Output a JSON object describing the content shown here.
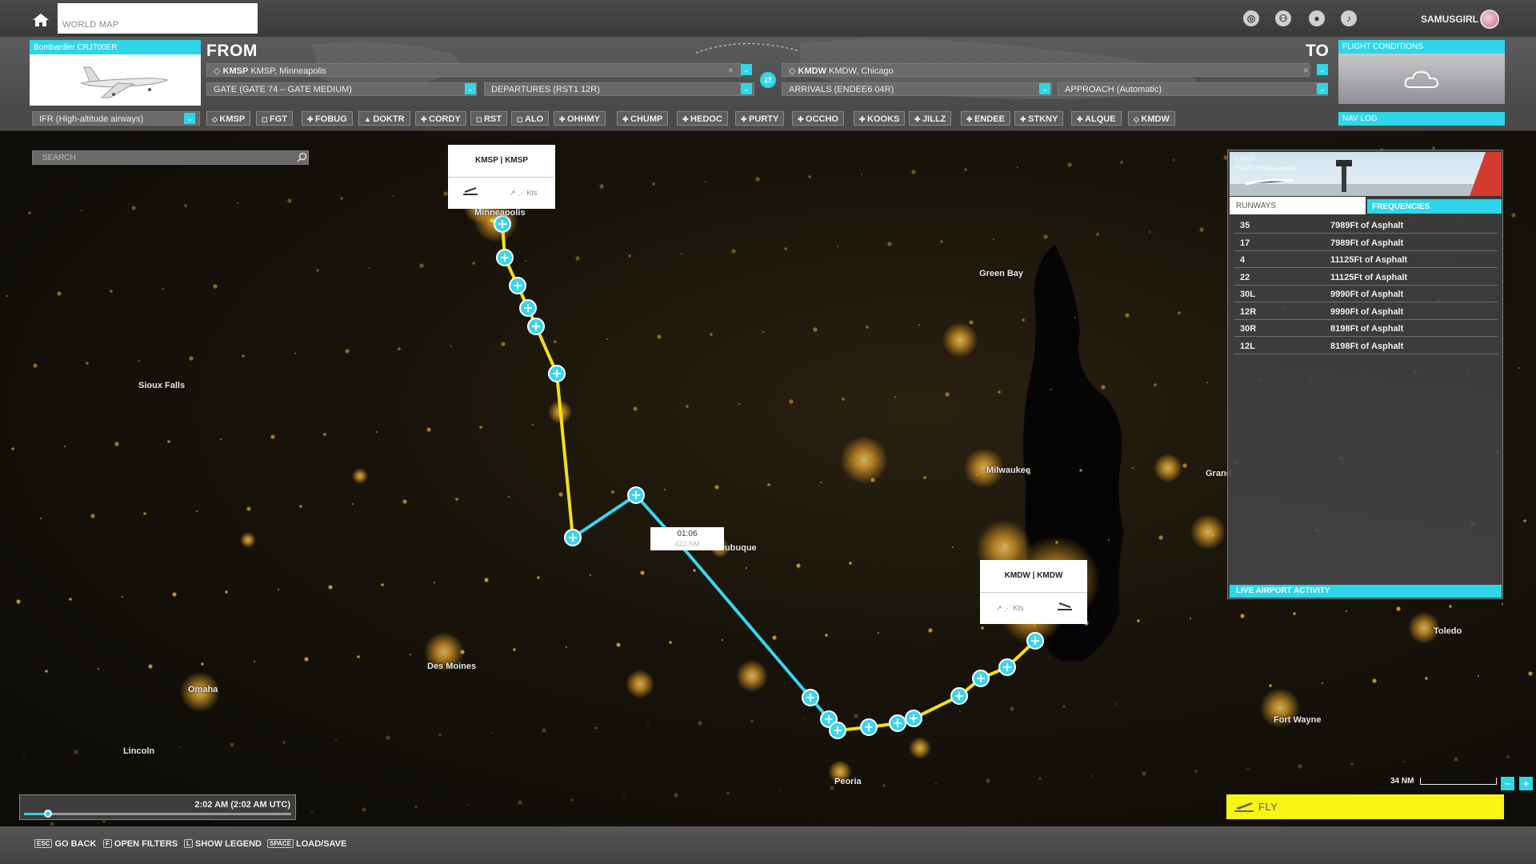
{
  "topbar": {
    "tab_label": "WORLD MAP",
    "username": "SAMUSGIRL"
  },
  "aircraft": {
    "name": "Bombardier CRJ700ER"
  },
  "route": {
    "from_label": "FROM",
    "to_label": "TO",
    "from_code": "KMSP",
    "from_name": "KMSP, Minneapolis",
    "to_code": "KMDW",
    "to_name": "KMDW, Chicago",
    "gate": "GATE (GATE 74 – GATE MEDIUM)",
    "departure": "DEPARTURES (RST1 12R)",
    "arrival": "ARRIVALS (ENDEE6 04R)",
    "approach": "APPROACH (Automatic)",
    "flight_conditions_label": "FLIGHT CONDITIONS",
    "altitude_mode": "IFR (High-altitude airways)",
    "nav_log_label": "NAV LOG",
    "waypoints": [
      {
        "icon": "airport",
        "name": "KMSP"
      },
      {
        "icon": "vor",
        "name": "FGT"
      },
      {
        "icon": "intersection",
        "name": "FOBUG"
      },
      {
        "icon": "triangle",
        "name": "DOKTR"
      },
      {
        "icon": "intersection",
        "name": "CORDY"
      },
      {
        "icon": "vor",
        "name": "RST"
      },
      {
        "icon": "vor",
        "name": "ALO"
      },
      {
        "icon": "intersection",
        "name": "OHHMY"
      },
      {
        "icon": "intersection",
        "name": "CHUMP"
      },
      {
        "icon": "intersection",
        "name": "HEDOC"
      },
      {
        "icon": "intersection",
        "name": "PURTY"
      },
      {
        "icon": "intersection",
        "name": "OCCHO"
      },
      {
        "icon": "intersection",
        "name": "KOOKS"
      },
      {
        "icon": "intersection",
        "name": "JILLZ"
      },
      {
        "icon": "intersection",
        "name": "ENDEE"
      },
      {
        "icon": "intersection",
        "name": "STKNY"
      },
      {
        "icon": "intersection",
        "name": "ALQUE"
      },
      {
        "icon": "airport",
        "name": "KMDW"
      }
    ]
  },
  "map": {
    "search_placeholder": "SEARCH",
    "cities": [
      "Sioux Falls",
      "Green Bay",
      "Milwaukee",
      "Dubuque",
      "Des Moines",
      "Omaha",
      "Lincoln",
      "Peoria",
      "Fort Wayne",
      "Toledo",
      "Grand",
      "Minneapolis"
    ],
    "origin_card": {
      "code": "KMSP",
      "name": "KMSP",
      "speed_unit": "Kts"
    },
    "dest_card": {
      "code": "KMDW",
      "name": "KMDW",
      "speed_unit": "Kts"
    },
    "leg_time": "01:06",
    "leg_distance": "422 NM",
    "scale_label": "34 NM"
  },
  "airport_panel": {
    "photo_caption": "KMSP",
    "photo_subcaption": "KMSP, Minneapolis",
    "tab_runways": "RUNWAYS",
    "tab_frequencies": "FREQUENCIES",
    "runways": [
      {
        "number": "35",
        "detail": "7989Ft of Asphalt"
      },
      {
        "number": "17",
        "detail": "7989Ft of Asphalt"
      },
      {
        "number": "4",
        "detail": "11125Ft of Asphalt"
      },
      {
        "number": "22",
        "detail": "11125Ft of Asphalt"
      },
      {
        "number": "30L",
        "detail": "9990Ft of Asphalt"
      },
      {
        "number": "12R",
        "detail": "9990Ft of Asphalt"
      },
      {
        "number": "30R",
        "detail": "8198Ft of Asphalt"
      },
      {
        "number": "12L",
        "detail": "8198Ft of Asphalt"
      }
    ],
    "live_activity_label": "LIVE AIRPORT ACTIVITY"
  },
  "time": {
    "label": "2:02 AM (2:02 AM UTC)",
    "progress": 0.09
  },
  "fly_label": "FLY",
  "bottom_hints": [
    {
      "key": "ESC",
      "label": "GO BACK"
    },
    {
      "key": "F",
      "label": "OPEN FILTERS"
    },
    {
      "key": "L",
      "label": "SHOW LEGEND"
    },
    {
      "key": "SPACE",
      "label": "LOAD/SAVE"
    }
  ],
  "colors": {
    "accent": "#2fd6ea",
    "fly": "#f8f512",
    "route_yellow": "#f5e10a",
    "route_cyan": "#3ad5ee"
  }
}
